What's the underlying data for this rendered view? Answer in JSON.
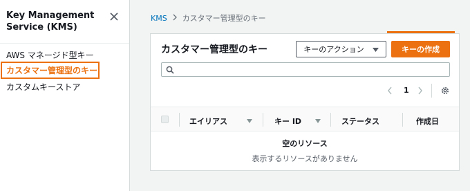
{
  "sidebar": {
    "title": "Key Management Service (KMS)",
    "items": [
      {
        "label": "AWS マネージド型キー"
      },
      {
        "label": "カスタマー管理型のキー"
      },
      {
        "label": "カスタムキーストア"
      }
    ]
  },
  "breadcrumb": {
    "root": "KMS",
    "current": "カスタマー管理型のキー"
  },
  "panel": {
    "title": "カスタマー管理型のキー",
    "actions_label": "キーのアクション",
    "create_label": "キーの作成",
    "search_placeholder": ""
  },
  "pagination": {
    "current_page": "1"
  },
  "table": {
    "columns": [
      "エイリアス",
      "キー ID",
      "ステータス",
      "作成日"
    ]
  },
  "empty_state": {
    "title": "空のリソース",
    "description": "表示するリソースがありません"
  },
  "colors": {
    "accent": "#ec7211",
    "link": "#0073bb",
    "highlight": "#ec7211"
  },
  "icons": [
    "close-icon",
    "chevron-right-icon",
    "caret-down-icon",
    "search-icon",
    "chevron-left-icon",
    "gear-icon"
  ]
}
